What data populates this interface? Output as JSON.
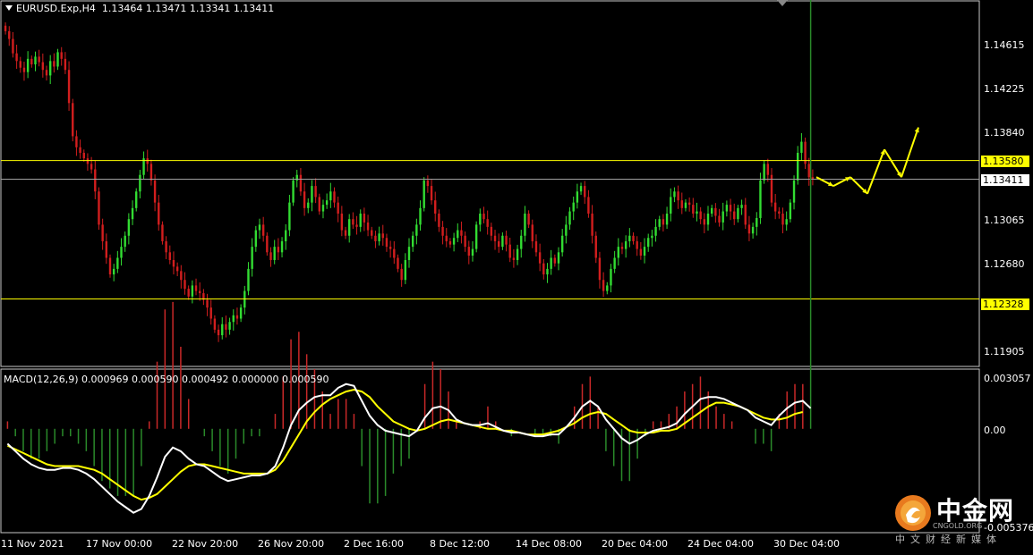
{
  "chart_header": {
    "symbol": "EURUSD.Exp,H4",
    "ohlc": "1.13464 1.13471 1.13341 1.13411"
  },
  "price_axis": [
    "1.14615",
    "1.14225",
    "1.13840",
    "1.13065",
    "1.12680",
    "1.11905"
  ],
  "price_tags": {
    "resistance": "1.13580",
    "current": "1.13411",
    "support": "1.12328"
  },
  "macd_header": "MACD(12,26,9) 0.000969 0.000590 0.000492 0.000000 0.000590",
  "macd_axis": [
    "0.003057",
    "0.00",
    "-0.005376"
  ],
  "time_axis": [
    "11 Nov 2021",
    "17 Nov 00:00",
    "22 Nov 20:00",
    "26 Nov 20:00",
    "2 Dec 16:00",
    "8 Dec 12:00",
    "14 Dec 08:00",
    "20 Dec 04:00",
    "24 Dec 04:00",
    "30 Dec 04:00"
  ],
  "watermark": {
    "brand": "中金网",
    "tagline": "中文财经新媒体",
    "domain": "CNGOLD.ORG"
  },
  "colors": {
    "background": "#000000",
    "bull_candle": "#32dc32",
    "bear_candle": "#d21e1e",
    "horizontal_line": "#ffff00",
    "current_price_line": "#a0a0a0",
    "forecast_arrow": "#ffff00",
    "macd_line": "#ffffff",
    "signal_line": "#ffff00",
    "histogram_positive": "#c82828",
    "histogram_negative": "#2a8a2a"
  },
  "chart_data": {
    "type": "candlestick",
    "symbol": "EURUSD.Exp",
    "timeframe": "H4",
    "ylim": [
      1.1175,
      1.15
    ],
    "horizontal_lines": [
      1.1358,
      1.12328
    ],
    "current_price": 1.13411,
    "closes": [
      1.1475,
      1.1468,
      1.1455,
      1.1448,
      1.1442,
      1.1438,
      1.145,
      1.1445,
      1.1452,
      1.1447,
      1.144,
      1.1435,
      1.1448,
      1.1443,
      1.1456,
      1.145,
      1.144,
      1.141,
      1.138,
      1.137,
      1.1365,
      1.136,
      1.1355,
      1.135,
      1.133,
      1.13,
      1.1285,
      1.127,
      1.1255,
      1.126,
      1.127,
      1.128,
      1.129,
      1.1305,
      1.1315,
      1.133,
      1.1345,
      1.136,
      1.1355,
      1.134,
      1.132,
      1.13,
      1.1285,
      1.1275,
      1.1268,
      1.1262,
      1.1258,
      1.125,
      1.1242,
      1.1235,
      1.1245,
      1.124,
      1.1238,
      1.1232,
      1.1225,
      1.1215,
      1.1205,
      1.12,
      1.121,
      1.1205,
      1.1212,
      1.1218,
      1.1215,
      1.1225,
      1.124,
      1.126,
      1.128,
      1.1295,
      1.13,
      1.129,
      1.1275,
      1.1268,
      1.128,
      1.1275,
      1.1285,
      1.1295,
      1.132,
      1.134,
      1.1345,
      1.133,
      1.1315,
      1.132,
      1.1335,
      1.1325,
      1.1312,
      1.1318,
      1.1322,
      1.133,
      1.132,
      1.131,
      1.1295,
      1.129,
      1.1305,
      1.13,
      1.1298,
      1.131,
      1.1302,
      1.1295,
      1.129,
      1.1285,
      1.1292,
      1.1288,
      1.128,
      1.1278,
      1.127,
      1.126,
      1.125,
      1.1268,
      1.128,
      1.129,
      1.13,
      1.1315,
      1.134,
      1.1335,
      1.1322,
      1.131,
      1.1298,
      1.129,
      1.1285,
      1.1282,
      1.1288,
      1.1295,
      1.129,
      1.128,
      1.1272,
      1.1278,
      1.13,
      1.131,
      1.1305,
      1.1298,
      1.129,
      1.1285,
      1.128,
      1.129,
      1.1282,
      1.127,
      1.1268,
      1.1278,
      1.129,
      1.131,
      1.13,
      1.1285,
      1.1275,
      1.1265,
      1.1255,
      1.126,
      1.127,
      1.1265,
      1.1275,
      1.129,
      1.13,
      1.1312,
      1.132,
      1.133,
      1.1335,
      1.1325,
      1.131,
      1.129,
      1.127,
      1.125,
      1.124,
      1.1245,
      1.126,
      1.127,
      1.128,
      1.1278,
      1.1285,
      1.129,
      1.1285,
      1.1278,
      1.1272,
      1.128,
      1.1288,
      1.129,
      1.1298,
      1.1305,
      1.13,
      1.131,
      1.1325,
      1.133,
      1.1322,
      1.1315,
      1.132,
      1.1318,
      1.131,
      1.1312,
      1.1305,
      1.13,
      1.131,
      1.1315,
      1.1308,
      1.1302,
      1.1312,
      1.1318,
      1.1312,
      1.1305,
      1.1315,
      1.1318,
      1.13,
      1.1292,
      1.1298,
      1.1306,
      1.134,
      1.1355,
      1.1345,
      1.132,
      1.1312,
      1.131,
      1.13,
      1.1305,
      1.132,
      1.134,
      1.1365,
      1.1375,
      1.1355,
      1.1343,
      1.1341
    ],
    "forecast_path": [
      1.1343,
      1.1335,
      1.1343,
      1.1328,
      1.1368,
      1.1343,
      1.1388
    ]
  },
  "macd_data": {
    "ylim": [
      -0.005376,
      0.003057
    ],
    "macd": [
      -0.0008,
      -0.0012,
      -0.0016,
      -0.0019,
      -0.0021,
      -0.0022,
      -0.0022,
      -0.0021,
      -0.0021,
      -0.0022,
      -0.0024,
      -0.0027,
      -0.0031,
      -0.0035,
      -0.0039,
      -0.0042,
      -0.0045,
      -0.0043,
      -0.0036,
      -0.0026,
      -0.0015,
      -0.001,
      -0.0012,
      -0.0016,
      -0.0019,
      -0.002,
      -0.0023,
      -0.0026,
      -0.0028,
      -0.0027,
      -0.0026,
      -0.0025,
      -0.0025,
      -0.0024,
      -0.002,
      -0.001,
      0.0002,
      0.001,
      0.0014,
      0.0017,
      0.0018,
      0.0018,
      0.0022,
      0.0024,
      0.0023,
      0.0015,
      0.0007,
      0.0002,
      -0.0001,
      -0.0002,
      -0.0003,
      -0.0004,
      -0.0001,
      0.0006,
      0.0011,
      0.0012,
      0.001,
      0.0005,
      0.0003,
      0.0002,
      0.0002,
      0.0003,
      0.0001,
      -0.0001,
      -0.0002,
      -0.0002,
      -0.0003,
      -0.0004,
      -0.0004,
      -0.0003,
      -0.0003,
      0.0001,
      0.0006,
      0.0012,
      0.0015,
      0.0012,
      0.0005,
      0.0,
      -0.0005,
      -0.0008,
      -0.0006,
      -0.0003,
      -0.0001,
      0.0,
      0.0001,
      0.0003,
      0.0008,
      0.0012,
      0.0016,
      0.0017,
      0.0017,
      0.0016,
      0.0014,
      0.0012,
      0.001,
      0.0006,
      0.0004,
      0.0002,
      0.0007,
      0.0011,
      0.0014,
      0.0015,
      0.0011
    ],
    "signal": [
      -0.0009,
      -0.0011,
      -0.0013,
      -0.0015,
      -0.0017,
      -0.0019,
      -0.002,
      -0.002,
      -0.002,
      -0.002,
      -0.0021,
      -0.0022,
      -0.0024,
      -0.0027,
      -0.003,
      -0.0033,
      -0.0036,
      -0.0038,
      -0.0037,
      -0.0035,
      -0.0031,
      -0.0027,
      -0.0023,
      -0.002,
      -0.0019,
      -0.0019,
      -0.002,
      -0.0021,
      -0.0022,
      -0.0023,
      -0.0024,
      -0.0024,
      -0.0024,
      -0.0024,
      -0.0022,
      -0.0017,
      -0.001,
      -0.0003,
      0.0004,
      0.0009,
      0.0013,
      0.0016,
      0.0018,
      0.002,
      0.0021,
      0.002,
      0.0017,
      0.0012,
      0.0008,
      0.0004,
      0.0002,
      0.0,
      -0.0001,
      0.0,
      0.0002,
      0.0004,
      0.0005,
      0.0004,
      0.0003,
      0.0002,
      0.0001,
      0.0,
      0.0,
      -0.0001,
      -0.0001,
      -0.0002,
      -0.0003,
      -0.0003,
      -0.0003,
      -0.0002,
      -0.0001,
      0.0001,
      0.0003,
      0.0006,
      0.0008,
      0.0009,
      0.0008,
      0.0005,
      0.0002,
      -0.0001,
      -0.0002,
      -0.0002,
      -0.0002,
      -0.0001,
      -0.0001,
      0.0,
      0.0003,
      0.0006,
      0.0009,
      0.0012,
      0.0014,
      0.0014,
      0.0013,
      0.0012,
      0.001,
      0.0008,
      0.0006,
      0.0005,
      0.0005,
      0.0006,
      0.0008,
      0.0009
    ]
  }
}
